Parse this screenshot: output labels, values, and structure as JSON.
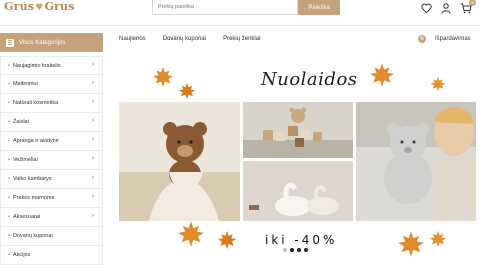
{
  "header": {
    "logo_left": "Grus",
    "logo_right": "Grus",
    "search_placeholder": "Prekių paieška",
    "search_button": "Paieška",
    "cart_count": "0"
  },
  "category_button": "Visos Kategorijos",
  "nav": {
    "items": [
      "Naujienos",
      "Dovanų kuponai",
      "Prekių ženklai"
    ],
    "sale_label": "Išpardavimas",
    "sale_icon": "%"
  },
  "sidebar": {
    "items": [
      {
        "label": "Naujagimio kraitelis",
        "has_sub": true
      },
      {
        "label": "Maitinimui",
        "has_sub": true
      },
      {
        "label": "Natūrali kosmetika",
        "has_sub": true
      },
      {
        "label": "Žaislai",
        "has_sub": true
      },
      {
        "label": "Apranga ir avalynė",
        "has_sub": true
      },
      {
        "label": "Vežimėliai",
        "has_sub": true
      },
      {
        "label": "Vaiko kambarys",
        "has_sub": true
      },
      {
        "label": "Prekės mamoms",
        "has_sub": true
      },
      {
        "label": "Aksesuarai",
        "has_sub": true
      },
      {
        "label": "Dovanų kuponai",
        "has_sub": false
      },
      {
        "label": "Akcijos",
        "has_sub": false
      }
    ]
  },
  "banner": {
    "title": "Nuolaidos",
    "promo": "iki -40%",
    "slides": 4,
    "active_slide": 0
  },
  "colors": {
    "accent": "#c5a27c",
    "leaf": "#e08a2a"
  }
}
